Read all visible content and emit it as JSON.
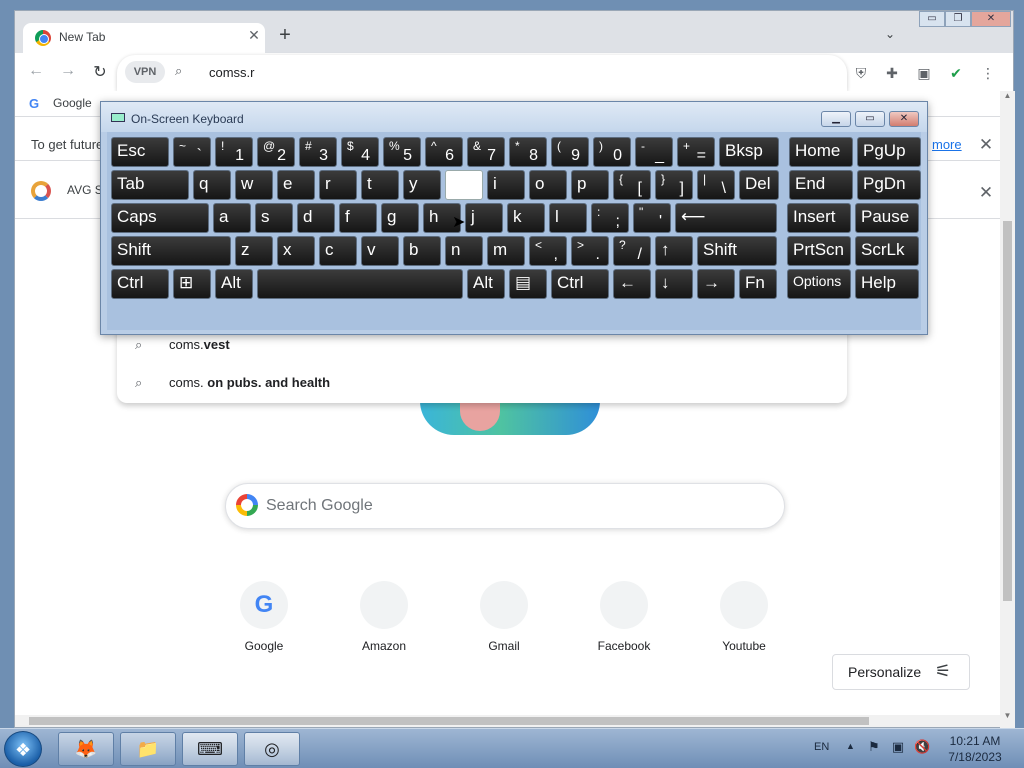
{
  "browser": {
    "tab_title": "New Tab",
    "tab_close": "✕",
    "new_tab": "+",
    "tab_menu": "⌄",
    "window_controls": [
      "▭",
      "❐",
      "✕"
    ]
  },
  "toolbar": {
    "back": "←",
    "forward": "→",
    "reload": "↻",
    "vpn_label": "VPN",
    "search_glyph": "⌕",
    "omnibox_value": "comss.r",
    "extensions": [
      "⛨",
      "✚",
      "▣",
      "✔",
      "⋮"
    ]
  },
  "bookmarks": {
    "google_label": "Google",
    "google_glyph": "G"
  },
  "infobar": {
    "text": "To get future",
    "link": "more",
    "close": "✕"
  },
  "infobar2": {
    "label": "AVG S",
    "close": "✕"
  },
  "suggestions": [
    {
      "icon": "⌕",
      "prefix": "coms.",
      "bold": "vest"
    },
    {
      "icon": "⌕",
      "prefix": "coms. ",
      "bold": "on pubs. and health"
    }
  ],
  "search": {
    "placeholder": "Search Google"
  },
  "shortcuts": [
    {
      "label": "Google",
      "glyph": "G"
    },
    {
      "label": "Amazon",
      "glyph": ""
    },
    {
      "label": "Gmail",
      "glyph": ""
    },
    {
      "label": "Facebook",
      "glyph": ""
    },
    {
      "label": "Youtube",
      "glyph": ""
    }
  ],
  "personalize": {
    "label": "Personalize",
    "icon": "⚟"
  },
  "scrollbar": {
    "up": "▲",
    "down": "▼"
  },
  "osk": {
    "title": "On-Screen Keyboard",
    "buttons": [
      "▁",
      "▭",
      "✕"
    ],
    "rows": [
      [
        {
          "main": "Esc",
          "w": 58
        },
        {
          "sub": "~",
          "sub2": "`",
          "w": 38
        },
        {
          "sub": "!",
          "sub2": "1",
          "w": 38
        },
        {
          "sub": "@",
          "sub2": "2",
          "w": 38
        },
        {
          "sub": "#",
          "sub2": "3",
          "w": 38
        },
        {
          "sub": "$",
          "sub2": "4",
          "w": 38
        },
        {
          "sub": "%",
          "sub2": "5",
          "w": 38
        },
        {
          "sub": "^",
          "sub2": "6",
          "w": 38
        },
        {
          "sub": "&",
          "sub2": "7",
          "w": 38
        },
        {
          "sub": "*",
          "sub2": "8",
          "w": 38
        },
        {
          "sub": "(",
          "sub2": "9",
          "w": 38
        },
        {
          "sub": ")",
          "sub2": "0",
          "w": 38
        },
        {
          "sub": "-",
          "sub2": "_",
          "w": 38
        },
        {
          "sub": "+",
          "sub2": "=",
          "w": 38
        },
        {
          "main": "Bksp",
          "w": 60
        },
        {
          "main": "Home",
          "w": 64,
          "gap": 6
        },
        {
          "main": "PgUp",
          "w": 64
        }
      ],
      [
        {
          "main": "Tab",
          "w": 78
        },
        {
          "main": "q",
          "w": 38
        },
        {
          "main": "w",
          "w": 38
        },
        {
          "main": "e",
          "w": 38
        },
        {
          "main": "r",
          "w": 38
        },
        {
          "main": "t",
          "w": 38
        },
        {
          "main": "y",
          "w": 38
        },
        {
          "main": "",
          "w": 38,
          "hi": true
        },
        {
          "main": "i",
          "w": 38
        },
        {
          "main": "o",
          "w": 38
        },
        {
          "main": "p",
          "w": 38
        },
        {
          "sub": "{",
          "sub2": "[",
          "w": 38
        },
        {
          "sub": "}",
          "sub2": "]",
          "w": 38
        },
        {
          "sub": "|",
          "sub2": "\\",
          "w": 38
        },
        {
          "main": "Del",
          "w": 40
        },
        {
          "main": "End",
          "w": 64,
          "gap": 6
        },
        {
          "main": "PgDn",
          "w": 64
        }
      ],
      [
        {
          "main": "Caps",
          "w": 98
        },
        {
          "main": "a",
          "w": 38
        },
        {
          "main": "s",
          "w": 38
        },
        {
          "main": "d",
          "w": 38
        },
        {
          "main": "f",
          "w": 38
        },
        {
          "main": "g",
          "w": 38
        },
        {
          "main": "h",
          "w": 38
        },
        {
          "main": "j",
          "w": 38
        },
        {
          "main": "k",
          "w": 38
        },
        {
          "main": "l",
          "w": 38
        },
        {
          "sub": ":",
          "sub2": ";",
          "w": 38
        },
        {
          "sub": "\"",
          "sub2": "'",
          "w": 38
        },
        {
          "main": "⟵",
          "w": 102
        },
        {
          "main": "Insert",
          "w": 64,
          "gap": 6
        },
        {
          "main": "Pause",
          "w": 64
        }
      ],
      [
        {
          "main": "Shift",
          "w": 120
        },
        {
          "main": "z",
          "w": 38
        },
        {
          "main": "x",
          "w": 38
        },
        {
          "main": "c",
          "w": 38
        },
        {
          "main": "v",
          "w": 38
        },
        {
          "main": "b",
          "w": 38
        },
        {
          "main": "n",
          "w": 38
        },
        {
          "main": "m",
          "w": 38
        },
        {
          "sub": "<",
          "sub2": ",",
          "w": 38
        },
        {
          "sub": ">",
          "sub2": ".",
          "w": 38
        },
        {
          "sub": "?",
          "sub2": "/",
          "w": 38
        },
        {
          "main": "↑",
          "w": 38
        },
        {
          "main": "Shift",
          "w": 80
        },
        {
          "main": "PrtScn",
          "w": 64,
          "gap": 6
        },
        {
          "main": "ScrLk",
          "w": 64
        }
      ],
      [
        {
          "main": "Ctrl",
          "w": 58
        },
        {
          "main": "⊞",
          "w": 38
        },
        {
          "main": "Alt",
          "w": 38
        },
        {
          "main": "",
          "w": 206
        },
        {
          "main": "Alt",
          "w": 38
        },
        {
          "main": "▤",
          "w": 38
        },
        {
          "main": "Ctrl",
          "w": 58
        },
        {
          "main": "←",
          "w": 38
        },
        {
          "main": "↓",
          "w": 38
        },
        {
          "main": "→",
          "w": 38
        },
        {
          "main": "Fn",
          "w": 38
        },
        {
          "main": "Options",
          "w": 64,
          "gap": 6,
          "small": true
        },
        {
          "main": "Help",
          "w": 64
        }
      ]
    ]
  },
  "taskbar": {
    "start_glyph": "❖",
    "items": [
      "🦊",
      "📁",
      "⌨",
      "◎"
    ],
    "lang": "EN",
    "tray_arrow": "▲",
    "tray_icons": [
      "⚑",
      "▣",
      "🔇"
    ],
    "time": "10:21 AM",
    "date": "7/18/2023"
  }
}
